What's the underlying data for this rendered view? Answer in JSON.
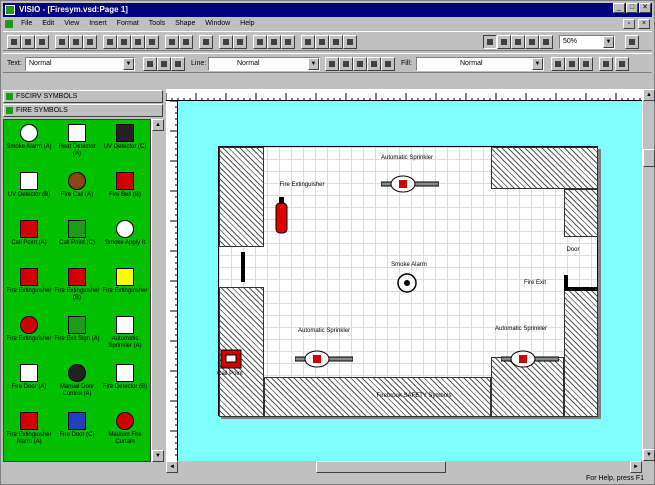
{
  "window": {
    "title": "VISIO - [Firesym.vsd:Page 1]",
    "minimize": "_",
    "maximize": "□",
    "close": "✕"
  },
  "menu": [
    "File",
    "Edit",
    "View",
    "Insert",
    "Format",
    "Tools",
    "Shape",
    "Window",
    "Help"
  ],
  "format_toolbar": {
    "text_label": "Text:",
    "text_style": "Normal",
    "line_label": "Line:",
    "line_style": "Normal",
    "fill_label": "Fill:",
    "fill_style": "Normal",
    "zoom": "50%"
  },
  "stencils": {
    "header1": "FSCIRV SYMBOLS",
    "header2": "FIRE SYMBOLS",
    "shapes": [
      {
        "label": "Smoke Alarm (A)",
        "icon": "smoke-alarm-icon"
      },
      {
        "label": "Heat Detector (A)",
        "icon": "heat-detector-icon"
      },
      {
        "label": "UV Detector (C)",
        "icon": "uv-detector-icon"
      },
      {
        "label": "UV Detector (B)",
        "icon": "uv-detector-b-icon"
      },
      {
        "label": "Fire Call (A)",
        "icon": "fire-call-icon"
      },
      {
        "label": "Fire Bell (B)",
        "icon": "fire-bell-icon"
      },
      {
        "label": "Call Point (A)",
        "icon": "call-point-a-icon"
      },
      {
        "label": "Call Point (C)",
        "icon": "call-point-c-icon"
      },
      {
        "label": "Smoke Apply It",
        "icon": "smoke-apply-icon"
      },
      {
        "label": "Fire Extinguisher",
        "icon": "extinguisher-1-icon"
      },
      {
        "label": "Fire Extinguisher (B)",
        "icon": "extinguisher-2-icon"
      },
      {
        "label": "Fire Extinguisher",
        "icon": "extinguisher-3-icon"
      },
      {
        "label": "Fire Extinguisher",
        "icon": "extinguisher-4-icon"
      },
      {
        "label": "Fire Exit Sign (A)",
        "icon": "exit-sign-icon"
      },
      {
        "label": "Automatic Sprinkler (A)",
        "icon": "sprinkler-icon"
      },
      {
        "label": "Fire Door (A)",
        "icon": "fire-door-icon"
      },
      {
        "label": "Manual Door Control (A)",
        "icon": "door-control-icon"
      },
      {
        "label": "Fire Detector (B)",
        "icon": "fire-detector-icon"
      },
      {
        "label": "Fire Extinguisher Alarm (A)",
        "icon": "ext-alarm-icon"
      },
      {
        "label": "Fire Door (C)",
        "icon": "fire-door-c-icon"
      },
      {
        "label": "Medium Fire Curtain",
        "icon": "fire-curtain-icon"
      }
    ]
  },
  "drawing": {
    "fire_extinguisher": "Fire Extinguisher",
    "sprinkler_top": "Automatic Sprinkler",
    "smoke_alarm": "Smoke Alarm",
    "sprinkler_left": "Automatic Sprinkler",
    "sprinkler_right": "Automatic Sprinkler",
    "call_point": "Call Point",
    "fire_exit": "Fire Exit",
    "door_label": "Door",
    "footer": "Firebrook SAFETY Symbols"
  },
  "status": {
    "left": "",
    "right": "For Help, press F1"
  },
  "colors": {
    "title_bg": "#000080",
    "stencil_bg": "#00c000",
    "canvas_bg": "#80ffff"
  }
}
